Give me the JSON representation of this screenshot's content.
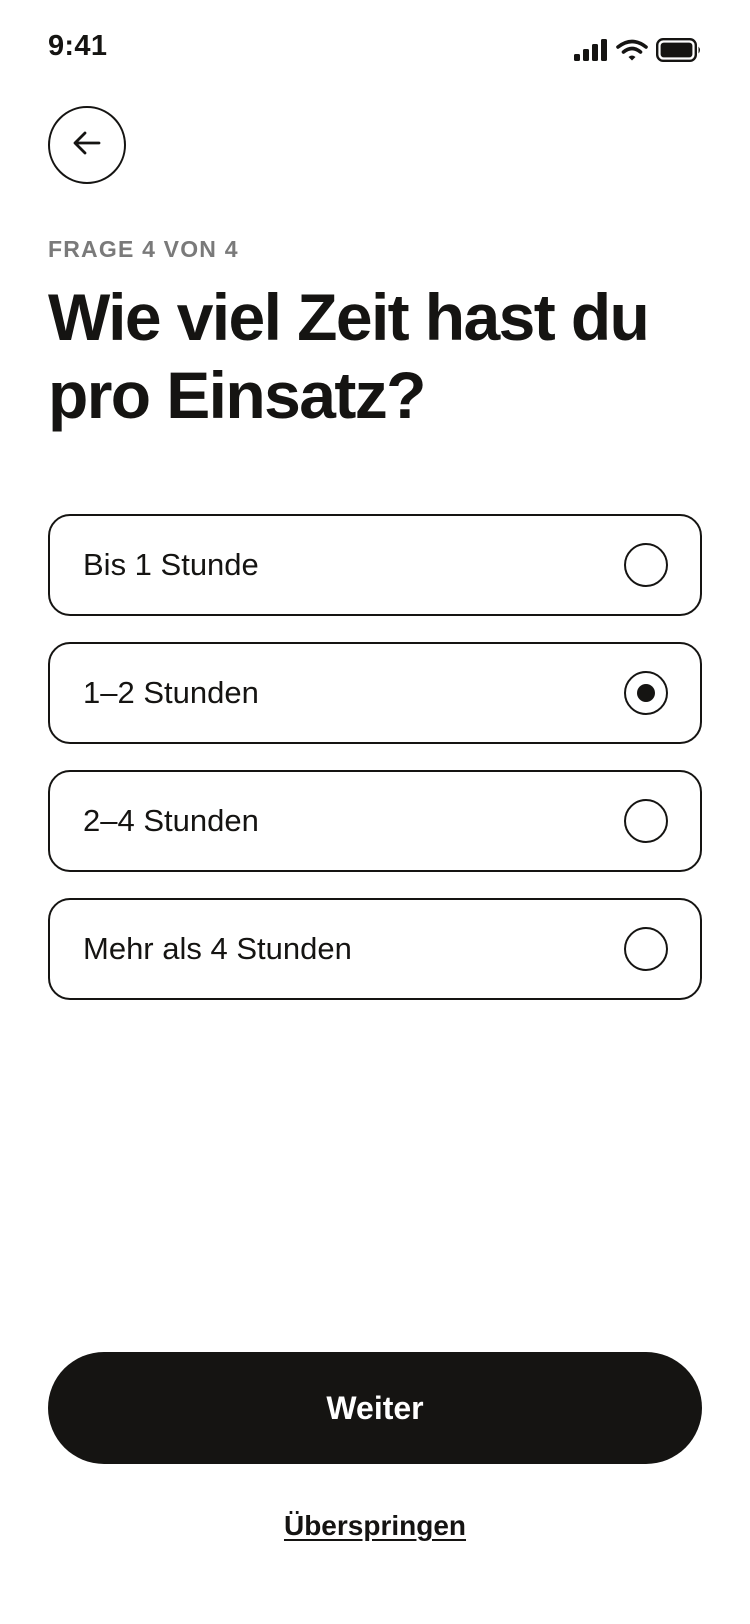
{
  "status_bar": {
    "time": "9:41",
    "icons": [
      "cellular-signal-icon",
      "wifi-icon",
      "battery-icon"
    ]
  },
  "header": {
    "back_icon": "arrow-left-icon"
  },
  "question": {
    "progress": "FRAGE 4 VON 4",
    "title": "Wie viel Zeit hast du pro Einsatz?"
  },
  "options": [
    {
      "label": "Bis 1 Stunde",
      "selected": false
    },
    {
      "label": "1–2 Stunden",
      "selected": true
    },
    {
      "label": "2–4 Stunden",
      "selected": false
    },
    {
      "label": "Mehr als 4 Stunden",
      "selected": false
    }
  ],
  "actions": {
    "continue_label": "Weiter",
    "skip_label": "Überspringen"
  },
  "colors": {
    "primary": "#151412",
    "muted": "#7a7a7a",
    "background": "#ffffff"
  }
}
